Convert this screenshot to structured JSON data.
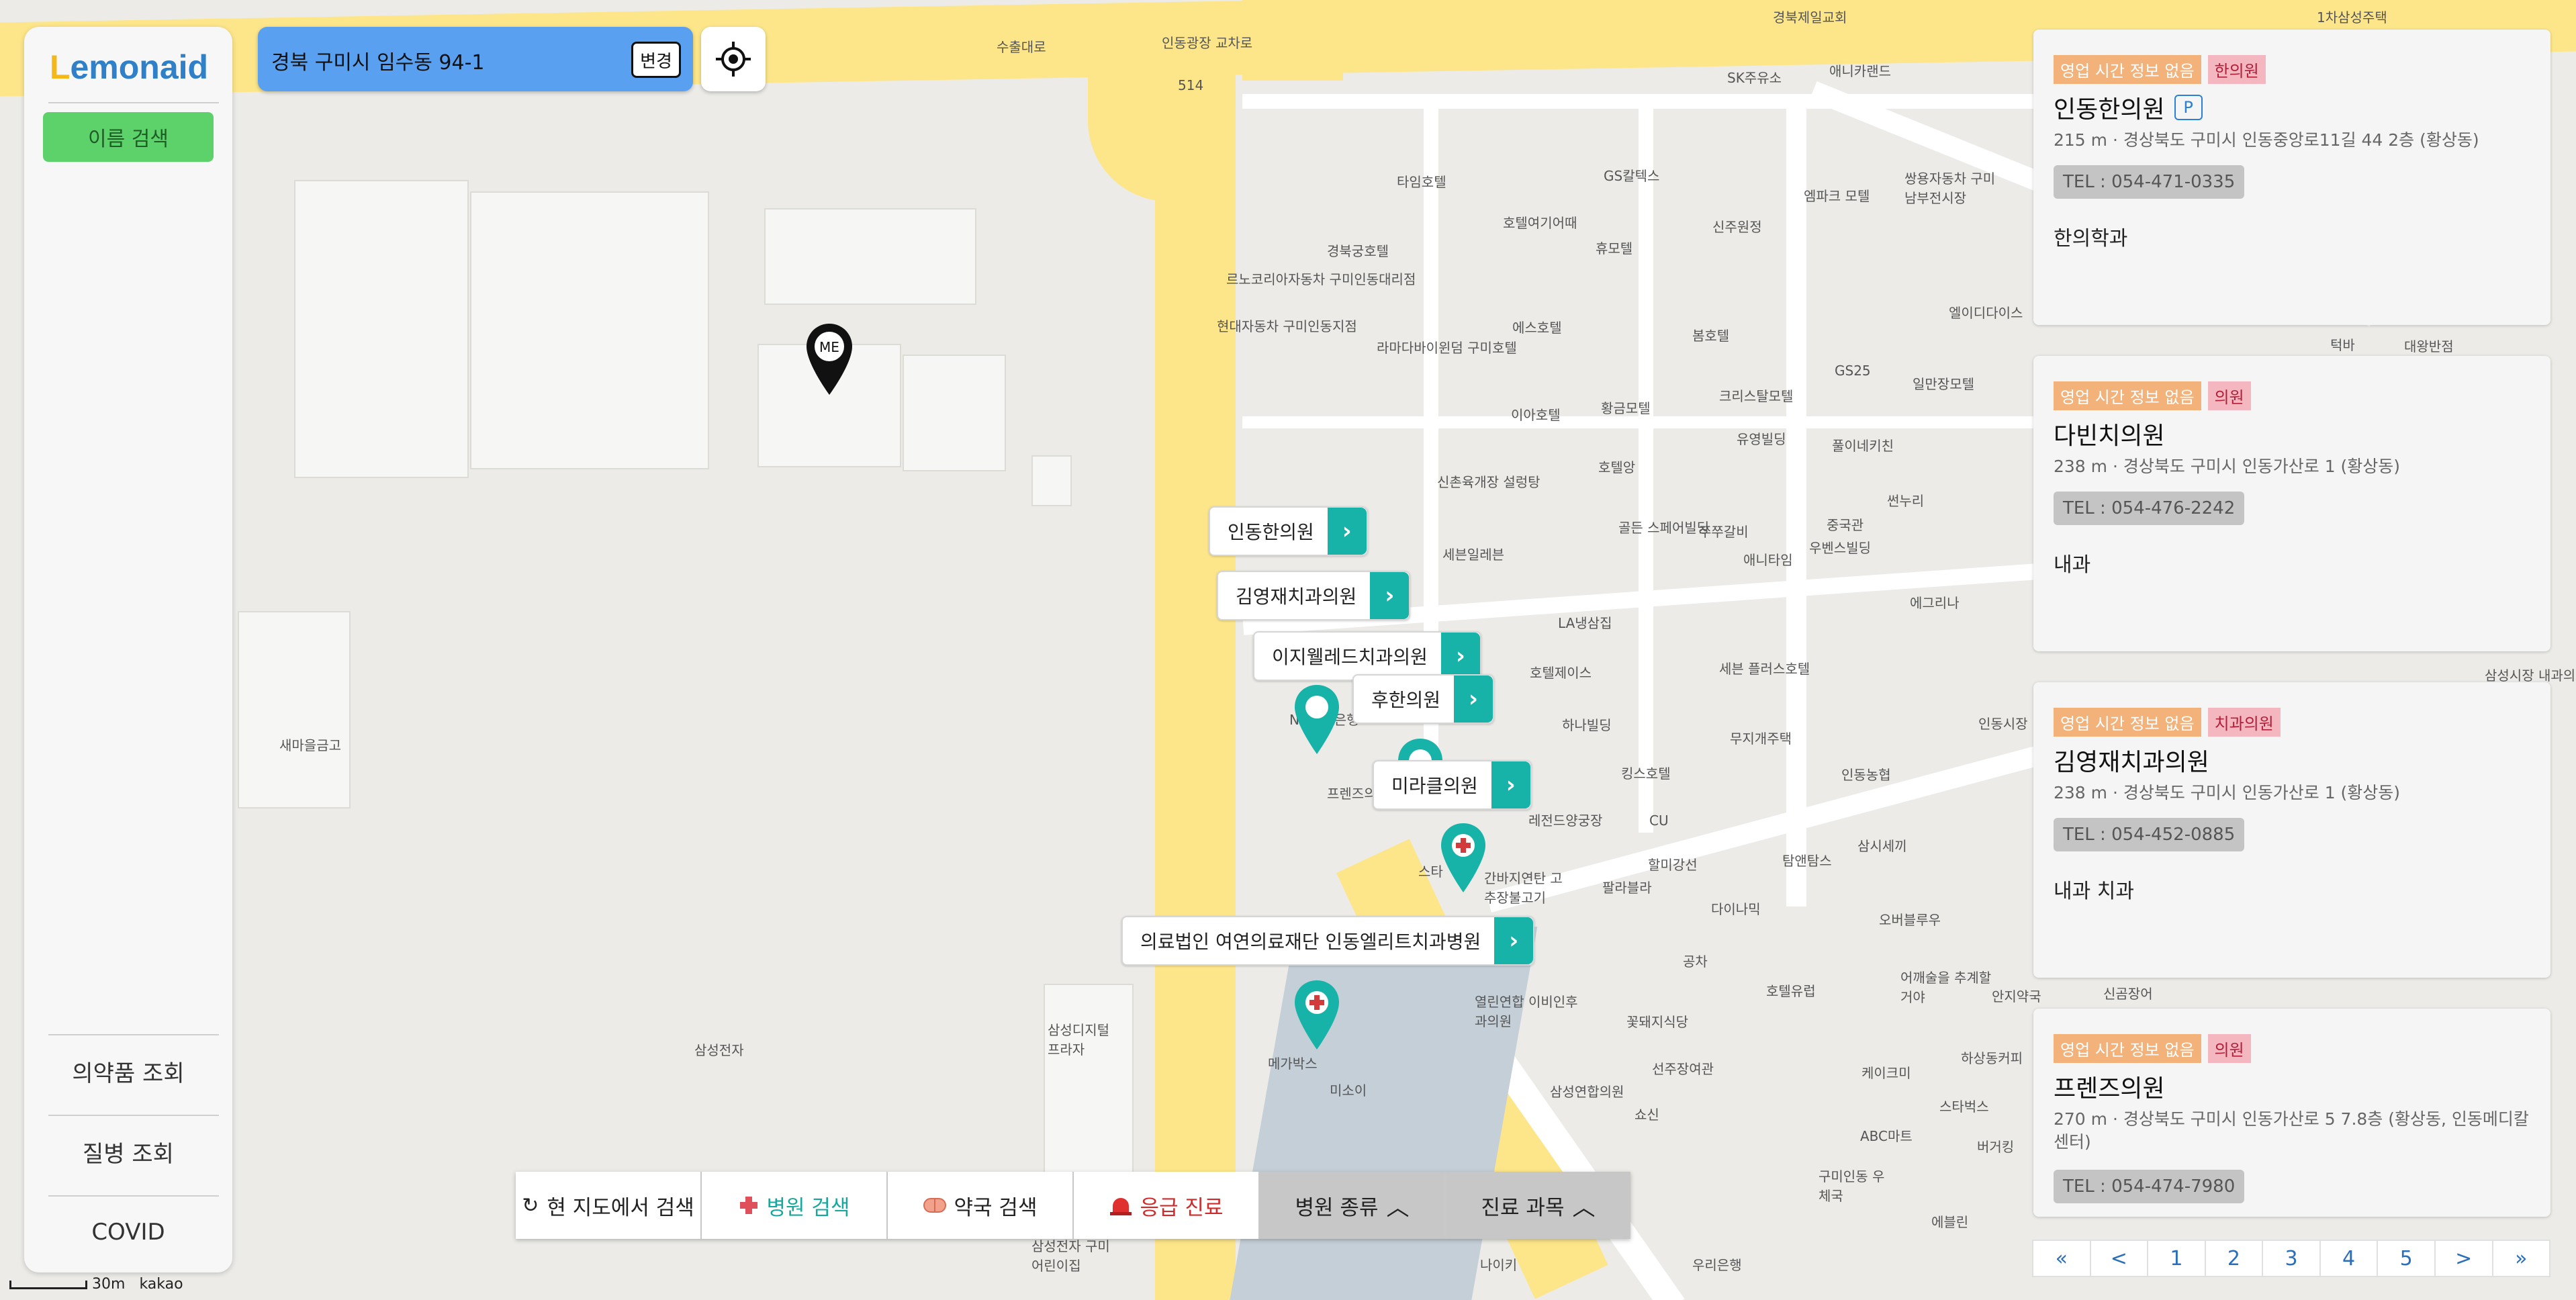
{
  "app": {
    "brand": "Lemonaid"
  },
  "sidebar": {
    "name_search": "이름 검색",
    "links": [
      "의약품 조회",
      "질병 조회",
      "COVID"
    ]
  },
  "address": {
    "text": "경북 구미시 임수동 94-1",
    "change_label": "변경"
  },
  "map": {
    "me_label": "ME",
    "labels": [
      "수출대로",
      "인동광장 교차로",
      "514",
      "SK주유소",
      "애니카랜드",
      "타임호텔",
      "GS칼텍스",
      "호텔여기어때",
      "경북궁호텔",
      "휴모텔",
      "르노코리아자동차 구미인동대리점",
      "현대자동차 구미인동지점",
      "라마다바이윈덤 구미호텔",
      "에스호텔",
      "봄호텔",
      "이아호텔",
      "황금모텔",
      "호텔앙",
      "신촌육개장 설렁탕",
      "세븐일레븐",
      "골든 스페어빌딩",
      "쭈쭈갈비",
      "애니타임",
      "LA냉삼집",
      "호텔제이스",
      "세븐 플러스호텔",
      "하나빌딩",
      "무지개주택",
      "킹스호텔",
      "인동농협",
      "레전드양궁장",
      "CU",
      "할미강선",
      "탐앤탐스",
      "간바지연탄 고추장불고기",
      "팔라블라",
      "다이나믹",
      "오버블루우",
      "삼성디지털 프라자",
      "삼성전자",
      "새마을금고",
      "메가박스",
      "미소이",
      "열린연합 이비인후과의원",
      "꽃돼지식당",
      "삼성연합의원",
      "선주장여관",
      "쇼신",
      "공차",
      "호텔유럽",
      "어깨술을 추계할거야",
      "케이크미",
      "하상동커피",
      "스타벅스",
      "ABC마트",
      "구미인동 우체국",
      "에블린",
      "버거킹",
      "나이키",
      "우리은행",
      "삼성전자 구미어린이집",
      "경북제일교회",
      "1차삼성주택",
      "엠파크 모텔",
      "쌍용자동차 구미남부전시장",
      "신주원정",
      "엘이디다이스",
      "GS25",
      "일만장모텔",
      "크리스탈모텔",
      "유영빌딩",
      "풀이네키친",
      "썬누리",
      "중국관",
      "우벤스빌딩",
      "에그리나",
      "인동시장",
      "삼시세끼",
      "안지약국",
      "신곰장어",
      "삼성시장 내과의원",
      "턱바",
      "대왕반점",
      "NH농협은행",
      "프렌즈의원",
      "스타"
    ],
    "scale": "30m",
    "provider": "kakao"
  },
  "hospitals": [
    {
      "label": "인동한의원"
    },
    {
      "label": "김영재치과의원"
    },
    {
      "label": "이지웰레드치과의원"
    },
    {
      "label": "후한의원"
    },
    {
      "label": "미라클의원"
    },
    {
      "label": "의료법인 여연의료재단 인동엘리트치과병원"
    }
  ],
  "toolbar": {
    "refresh": "현 지도에서 검색",
    "hospital_search": "병원 검색",
    "pharmacy_search": "약국 검색",
    "emergency": "응급 진료",
    "hospital_type": "병원 종류",
    "department": "진료 과목"
  },
  "list": [
    {
      "hours": "영업 시간 정보 없음",
      "category": "한의원",
      "name": "인동한의원",
      "parking": "P",
      "distance": "215 m · 경상북도 구미시 인동중앙로11길 44 2층 (황상동)",
      "tel": "TEL : 054-471-0335",
      "dept": "한의학과"
    },
    {
      "hours": "영업 시간 정보 없음",
      "category": "의원",
      "name": "다빈치의원",
      "parking": "",
      "distance": "238 m · 경상북도 구미시 인동가산로 1 (황상동)",
      "tel": "TEL : 054-476-2242",
      "dept": "내과"
    },
    {
      "hours": "영업 시간 정보 없음",
      "category": "치과의원",
      "name": "김영재치과의원",
      "parking": "",
      "distance": "238 m · 경상북도 구미시 인동가산로 1 (황상동)",
      "tel": "TEL : 054-452-0885",
      "dept": "내과 치과"
    },
    {
      "hours": "영업 시간 정보 없음",
      "category": "의원",
      "name": "프렌즈의원",
      "parking": "",
      "distance": "270 m · 경상북도 구미시 인동가산로 5 7.8층 (황상동, 인동메디칼센터)",
      "tel": "TEL : 054-474-7980",
      "dept": ""
    }
  ],
  "pager": [
    "«",
    "<",
    "1",
    "2",
    "3",
    "4",
    "5",
    ">",
    "»"
  ],
  "colors": {
    "teal": "#17b3a8",
    "green": "#5dd26a",
    "blue": "#5aa0f0",
    "road_yellow": "#fde68a"
  }
}
